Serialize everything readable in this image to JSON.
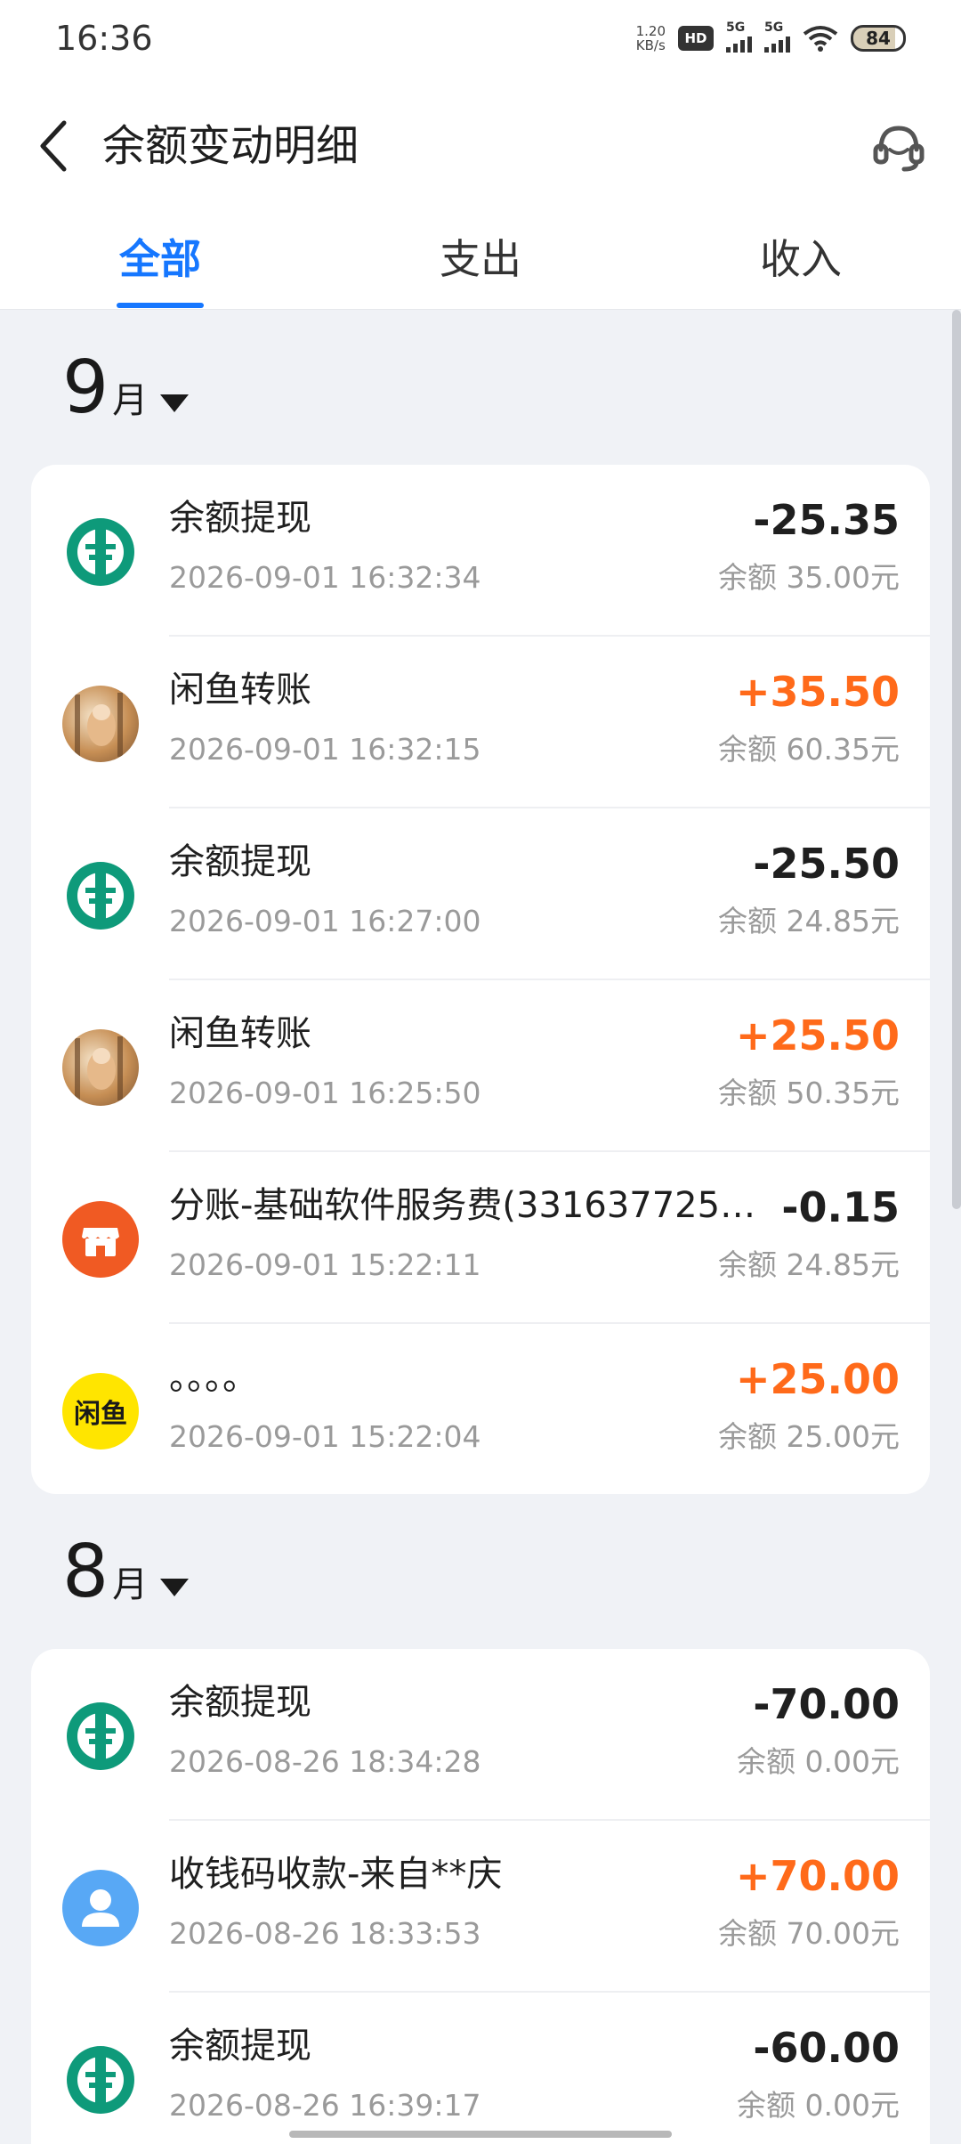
{
  "status_bar": {
    "time": "16:36",
    "net_speed_value": "1.20",
    "net_speed_unit": "KB/s",
    "hd_label": "HD",
    "signal1_label": "5G",
    "signal2_label": "5G",
    "battery": "84"
  },
  "header": {
    "title": "余额变动明细",
    "back_icon": "chevron-left-icon",
    "service_icon": "customer-service-headset-icon"
  },
  "tabs": [
    {
      "label": "全部",
      "active": true
    },
    {
      "label": "支出",
      "active": false
    },
    {
      "label": "收入",
      "active": false
    }
  ],
  "colors": {
    "accent": "#1677ff",
    "income": "#ff6a1a",
    "expense": "#1f1f1f",
    "background": "#f0f2f6"
  },
  "months": [
    {
      "month": "9",
      "unit": "月",
      "records": [
        {
          "icon": "bank-logo-icon",
          "title": "余额提现",
          "time": "2026-09-01 16:32:34",
          "amount": "-25.35",
          "type": "expense",
          "balance": "余额 35.00元"
        },
        {
          "icon": "user-photo-avatar",
          "title": "闲鱼转账",
          "time": "2026-09-01 16:32:15",
          "amount": "+35.50",
          "type": "income",
          "balance": "余额 60.35元"
        },
        {
          "icon": "bank-logo-icon",
          "title": "余额提现",
          "time": "2026-09-01 16:27:00",
          "amount": "-25.50",
          "type": "expense",
          "balance": "余额 24.85元"
        },
        {
          "icon": "user-photo-avatar",
          "title": "闲鱼转账",
          "time": "2026-09-01 16:25:50",
          "amount": "+25.50",
          "type": "income",
          "balance": "余额 50.35元"
        },
        {
          "icon": "store-icon",
          "title": "分账-基础软件服务费(3316377255…",
          "time": "2026-09-01 15:22:11",
          "amount": "-0.15",
          "type": "expense",
          "balance": "余额 24.85元"
        },
        {
          "icon": "xianyu-logo-icon",
          "title": "。。。。",
          "time": "2026-09-01 15:22:04",
          "amount": "+25.00",
          "type": "income",
          "balance": "余额 25.00元"
        }
      ]
    },
    {
      "month": "8",
      "unit": "月",
      "records": [
        {
          "icon": "bank-logo-icon",
          "title": "余额提现",
          "time": "2026-08-26 18:34:28",
          "amount": "-70.00",
          "type": "expense",
          "balance": "余额 0.00元"
        },
        {
          "icon": "person-icon",
          "title": "收钱码收款-来自**庆",
          "time": "2026-08-26 18:33:53",
          "amount": "+70.00",
          "type": "income",
          "balance": "余额 70.00元"
        },
        {
          "icon": "bank-logo-icon",
          "title": "余额提现",
          "time": "2026-08-26 16:39:17",
          "amount": "-60.00",
          "type": "expense",
          "balance": "余额 0.00元"
        }
      ]
    }
  ],
  "xianyu_logo_text": "闲鱼"
}
